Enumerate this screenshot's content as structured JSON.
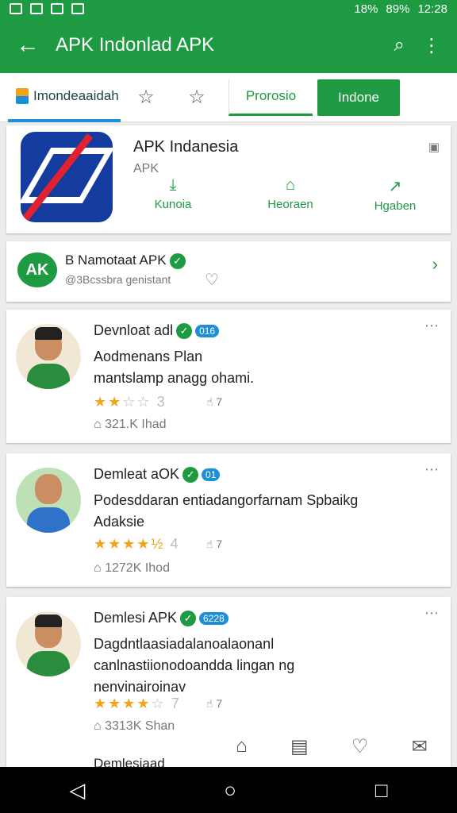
{
  "status": {
    "battery": "89%",
    "time": "12:28",
    "signal": "18%"
  },
  "appbar": {
    "title": "APK Indonlad APK"
  },
  "tabs": {
    "main": "Imondeaaidah",
    "outline": "Prorosio",
    "solid": "Indone"
  },
  "app": {
    "name": "APK Indanesia",
    "subtitle": "APK",
    "stats": [
      "Kunoia",
      "Heoraen",
      "Hgaben"
    ]
  },
  "developer": {
    "name": "B Namotaat APK",
    "subtitle": "@3Bcssbra genistant"
  },
  "reviews": [
    {
      "name": "Devnloat adl",
      "badge": "016",
      "text": "Aodmenans Plan\nmantslamp anagg ohami.",
      "rating_text": "3",
      "likes": "7",
      "meta": "321.K Ihad"
    },
    {
      "name": "Demleat aOK",
      "badge": "01",
      "text": "Podesddaran entiadangorfarnam Spbaikg\nAdaksie",
      "rating_text": "4",
      "likes": "7",
      "meta": "1272K Ihod"
    },
    {
      "name": "Demlesi APK",
      "badge": "6228",
      "text": "Dagdntlaasiadalanoalaonanl\ncanlnastiionodoandda lingan ng\nnenvinairoinav",
      "rating_text": "7",
      "likes": "7",
      "meta": "3313K Shan"
    }
  ],
  "partial_review": {
    "name": "Demlesiaad"
  }
}
